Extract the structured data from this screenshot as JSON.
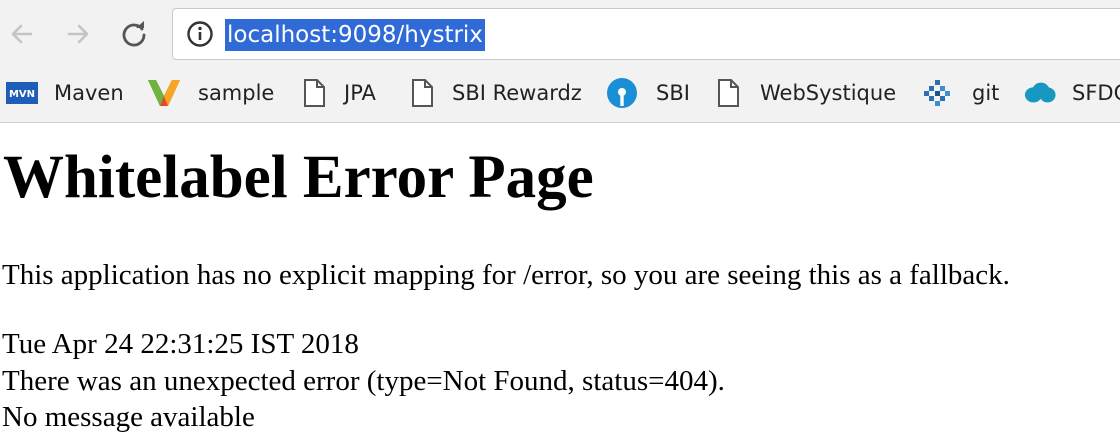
{
  "browser": {
    "url": "localhost:9098/hystrix",
    "back_icon": "arrow-left-icon",
    "forward_icon": "arrow-right-icon",
    "reload_icon": "reload-icon",
    "info_icon": "info-icon"
  },
  "bookmarks": [
    {
      "label": "Maven",
      "icon": "maven-icon"
    },
    {
      "label": "sample",
      "icon": "sample-m-icon"
    },
    {
      "label": "JPA",
      "icon": "page-icon"
    },
    {
      "label": "SBI Rewardz",
      "icon": "page-icon"
    },
    {
      "label": "SBI",
      "icon": "sbi-icon"
    },
    {
      "label": "WebSystique",
      "icon": "page-icon"
    },
    {
      "label": "git",
      "icon": "git-icon"
    },
    {
      "label": "SFDC",
      "icon": "salesforce-cloud-icon"
    }
  ],
  "page": {
    "heading": "Whitelabel Error Page",
    "message": "This application has no explicit mapping for /error, so you are seeing this as a fallback.",
    "timestamp": "Tue Apr 24 22:31:25 IST 2018",
    "error_line": "There was an unexpected error (type=Not Found, status=404).",
    "detail": "No message available"
  },
  "colors": {
    "url_selection": "#2f6ad6",
    "chrome_bg": "#f2f2f2",
    "maven_blue": "#1f5db8",
    "sbi_blue": "#1a8fd6",
    "salesforce_blue": "#1798c1"
  }
}
